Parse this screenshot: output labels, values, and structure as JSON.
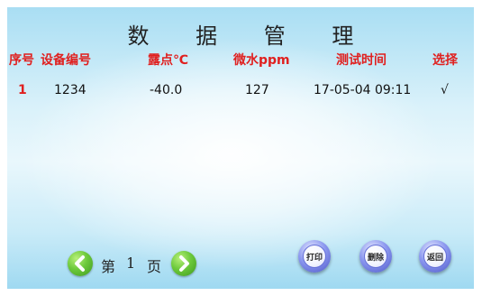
{
  "title": "数 据 管 理",
  "table": {
    "headers": [
      "序号",
      "设备编号",
      "露点℃",
      "微水ppm",
      "测试时间",
      "选择"
    ],
    "rows": [
      {
        "index": "1",
        "device_id": "1234",
        "dew_point": "-40.0",
        "micro_water": "127",
        "test_time": "17-05-04 09:11",
        "selected": "√"
      }
    ]
  },
  "pager": {
    "prefix": "第",
    "page": "1",
    "suffix": "页"
  },
  "buttons": {
    "print": "打印",
    "delete": "删除",
    "back": "返回"
  },
  "colors": {
    "header": "#e0201f",
    "arrow": "#6cc93b",
    "button": "#6570d8"
  }
}
